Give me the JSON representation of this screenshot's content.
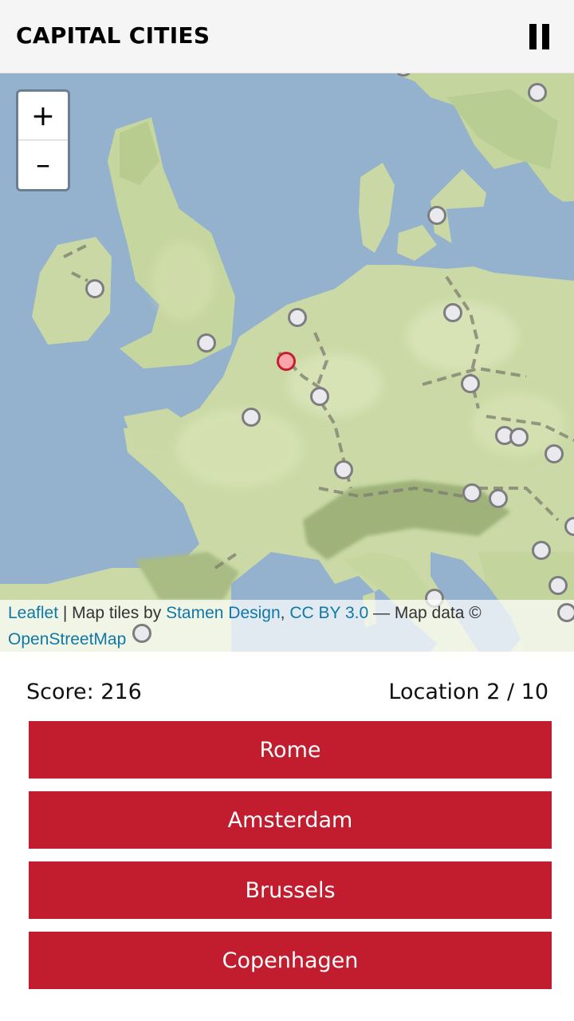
{
  "header": {
    "title": "CAPITAL CITIES",
    "pause_icon": "pause-icon"
  },
  "map": {
    "zoom_in_label": "+",
    "zoom_out_label": "–",
    "attribution": {
      "leaflet": "Leaflet",
      "sep1": " | Map tiles by ",
      "stamen": "Stamen Design",
      "comma": ", ",
      "license": "CC BY 3.0",
      "sep2": " — Map data © ",
      "osm": "OpenStreetMap"
    },
    "marker_colors": {
      "default_fill": "#e9e9ee",
      "default_border": "#7d7d80",
      "active_fill": "#f8a4aa",
      "active_border": "#c51f2f"
    }
  },
  "status": {
    "score": "Score: 216",
    "location": "Location 2 / 10"
  },
  "answers": [
    {
      "label": "Rome"
    },
    {
      "label": "Amsterdam"
    },
    {
      "label": "Brussels"
    },
    {
      "label": "Copenhagen"
    }
  ],
  "colors": {
    "accent": "#c11d2e",
    "header_bg": "#f5f5f5",
    "water": "#94b1cd",
    "land": "#c9d8a4"
  }
}
